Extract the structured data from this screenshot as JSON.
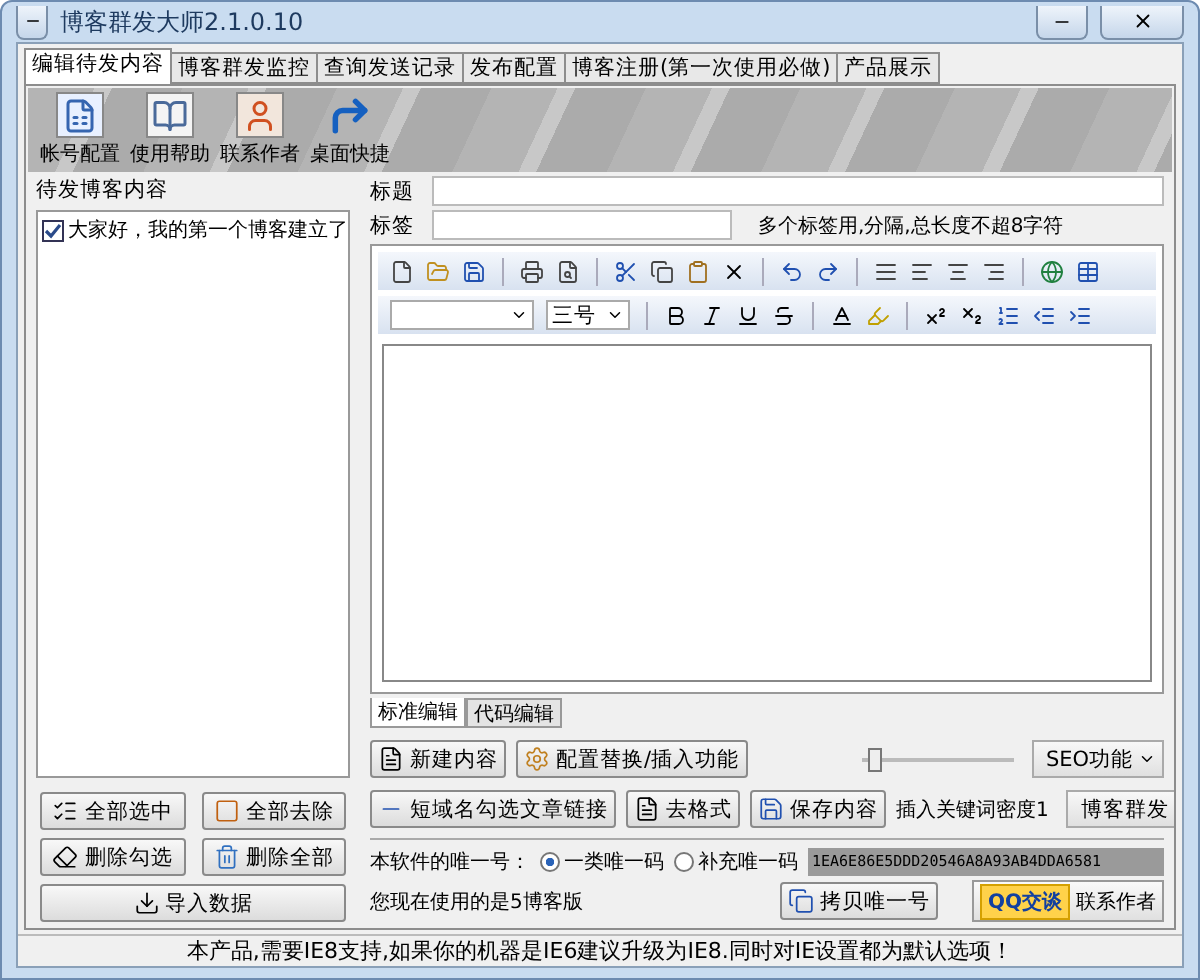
{
  "window": {
    "title": "博客群发大师2.1.0.10"
  },
  "tabs": [
    {
      "label": "编辑待发内容",
      "selected": true
    },
    {
      "label": "博客群发监控",
      "selected": false
    },
    {
      "label": "查询发送记录",
      "selected": false
    },
    {
      "label": "发布配置",
      "selected": false
    },
    {
      "label": "博客注册(第一次使用必做)",
      "selected": false
    },
    {
      "label": "产品展示",
      "selected": false
    }
  ],
  "toolbar": [
    {
      "label": "帐号配置",
      "kind": "doc"
    },
    {
      "label": "使用帮助",
      "kind": "book"
    },
    {
      "label": "联系作者",
      "kind": "person"
    },
    {
      "label": "桌面快捷",
      "kind": "arrow"
    }
  ],
  "left": {
    "group_title": "待发博客内容",
    "items": [
      {
        "text": "大家好，我的第一个博客建立了",
        "checked": true
      }
    ],
    "buttons": [
      {
        "label": "全部选中",
        "kind": "select"
      },
      {
        "label": "全部去除",
        "kind": "clear"
      },
      {
        "label": "删除勾选",
        "kind": "erase"
      },
      {
        "label": "删除全部",
        "kind": "dot"
      },
      {
        "label": "导入数据",
        "kind": "import"
      }
    ]
  },
  "form": {
    "title_label": "标题",
    "tags_label": "标签",
    "tags_hint": "多个标签用,分隔,总长度不超8字符"
  },
  "editor": {
    "font_size": "三号",
    "tabs": [
      {
        "label": "标准编辑",
        "selected": true
      },
      {
        "label": "代码编辑",
        "selected": false
      }
    ]
  },
  "actions": {
    "row1": [
      {
        "label": "新建内容",
        "kind": "new"
      },
      {
        "label": "配置替换/插入功能",
        "kind": "config"
      }
    ],
    "row2": [
      {
        "label": "短域名勾选文章链接",
        "kind": "pi"
      },
      {
        "label": "去格式",
        "kind": "new"
      },
      {
        "label": "保存内容",
        "kind": "save"
      }
    ],
    "density": {
      "level": 0.05,
      "label": "插入关键词密度1"
    },
    "dropdowns": [
      "SEO功能",
      "博客群发"
    ]
  },
  "unique": {
    "label": "本软件的唯一号：",
    "options": [
      {
        "label": "一类唯一码",
        "selected": true
      },
      {
        "label": "补充唯一码",
        "selected": false
      }
    ],
    "code": "1EA6E86E5DDD20546A8A93AB4DDA6581",
    "version_text": "您现在使用的是5博客版",
    "copy_button": "拷贝唯一号",
    "qq_badge": "QQ交谈",
    "contact": "联系作者"
  },
  "status_bar": "本产品,需要IE8支持,如果你的机器是IE6建议升级为IE8.同时对IE设置都为默认选项！"
}
